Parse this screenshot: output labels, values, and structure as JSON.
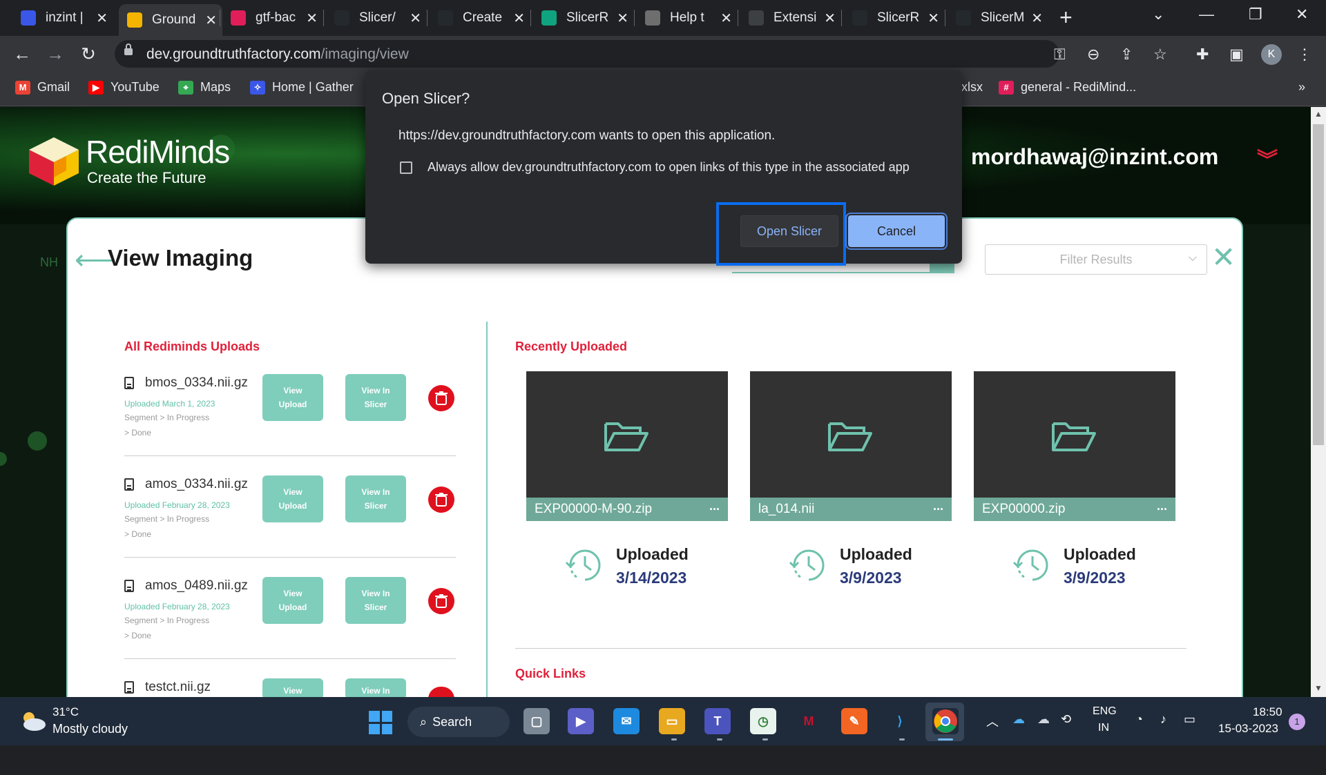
{
  "browser": {
    "tabs": [
      {
        "label": "inzint |",
        "icon": "inzint-icon",
        "color": "#3a57e8"
      },
      {
        "label": "Ground",
        "icon": "gtf-icon",
        "color": "#f4b400"
      },
      {
        "label": "gtf-bac",
        "icon": "slack-icon",
        "color": "#e01e5a"
      },
      {
        "label": "Slicer/",
        "icon": "github-icon",
        "color": "#24292e"
      },
      {
        "label": "Create",
        "icon": "github-copilot-icon",
        "color": "#24292e"
      },
      {
        "label": "SlicerR",
        "icon": "openai-icon",
        "color": "#10a37f"
      },
      {
        "label": "Help t",
        "icon": "help-icon",
        "color": "#6e6e6e"
      },
      {
        "label": "Extensi",
        "icon": "loading-icon",
        "color": "#3c4043"
      },
      {
        "label": "SlicerR",
        "icon": "github-icon",
        "color": "#24292e"
      },
      {
        "label": "SlicerM",
        "icon": "github-icon",
        "color": "#24292e"
      }
    ],
    "url_host": "dev.groundtruthfactory.com",
    "url_path": "/imaging/view",
    "profile_initial": "K",
    "bookmarks": [
      {
        "label": "Gmail",
        "icon": "gmail-icon",
        "color": "#ea4335"
      },
      {
        "label": "YouTube",
        "icon": "youtube-icon",
        "color": "#ff0000"
      },
      {
        "label": "Maps",
        "icon": "maps-icon",
        "color": "#34a853"
      },
      {
        "label": "Home | Gather",
        "icon": "gather-icon",
        "color": "#3a57e8"
      },
      {
        "label": "xlsx",
        "icon": "",
        "color": ""
      },
      {
        "label": "general - RediMind...",
        "icon": "slack-icon",
        "color": "#e01e5a"
      }
    ]
  },
  "site": {
    "brand": "RediMinds",
    "tagline": "Create the Future",
    "user_email": "mordhawaj@inzint.com",
    "page_title": "View Imaging",
    "nh_fragment": "NH",
    "filter_placeholder": "Filter Results"
  },
  "uploads": {
    "heading": "All Rediminds Uploads",
    "view_upload_label": "View Upload",
    "view_slicer_label": "View In Slicer",
    "segment_line": "Segment   >   In Progress",
    "done_line": "> Done",
    "items": [
      {
        "name": "bmos_0334.nii.gz",
        "date": "Uploaded March 1, 2023"
      },
      {
        "name": "amos_0334.nii.gz",
        "date": "Uploaded February 28, 2023"
      },
      {
        "name": "amos_0489.nii.gz",
        "date": "Uploaded February 28, 2023"
      },
      {
        "name": "testct.nii.gz",
        "date": ""
      }
    ],
    "partial_view_label": "View",
    "partial_view_in_label": "View In"
  },
  "recent": {
    "heading": "Recently Uploaded",
    "uploaded_label": "Uploaded",
    "items": [
      {
        "file": "EXP00000-M-90.zip",
        "date": "3/14/2023"
      },
      {
        "file": "la_014.nii",
        "date": "3/9/2023"
      },
      {
        "file": "EXP00000.zip",
        "date": "3/9/2023"
      }
    ]
  },
  "quick_links": {
    "heading": "Quick Links"
  },
  "dialog": {
    "title": "Open Slicer?",
    "message": "https://dev.groundtruthfactory.com wants to open this application.",
    "checkbox_label": "Always allow dev.groundtruthfactory.com to open links of this type in the associated app",
    "checkbox_checked": false,
    "open_label": "Open Slicer",
    "cancel_label": "Cancel"
  },
  "taskbar": {
    "temperature": "31°C",
    "weather": "Mostly cloudy",
    "search_label": "Search",
    "lang_top": "ENG",
    "lang_bottom": "IN",
    "time": "18:50",
    "date": "15-03-2023",
    "notifications": "1"
  },
  "colors": {
    "accent_teal": "#7fcdbb",
    "accent_red": "#e0213a",
    "dialog_bg": "#292a2d",
    "focus_blue": "#0a6cf0"
  }
}
